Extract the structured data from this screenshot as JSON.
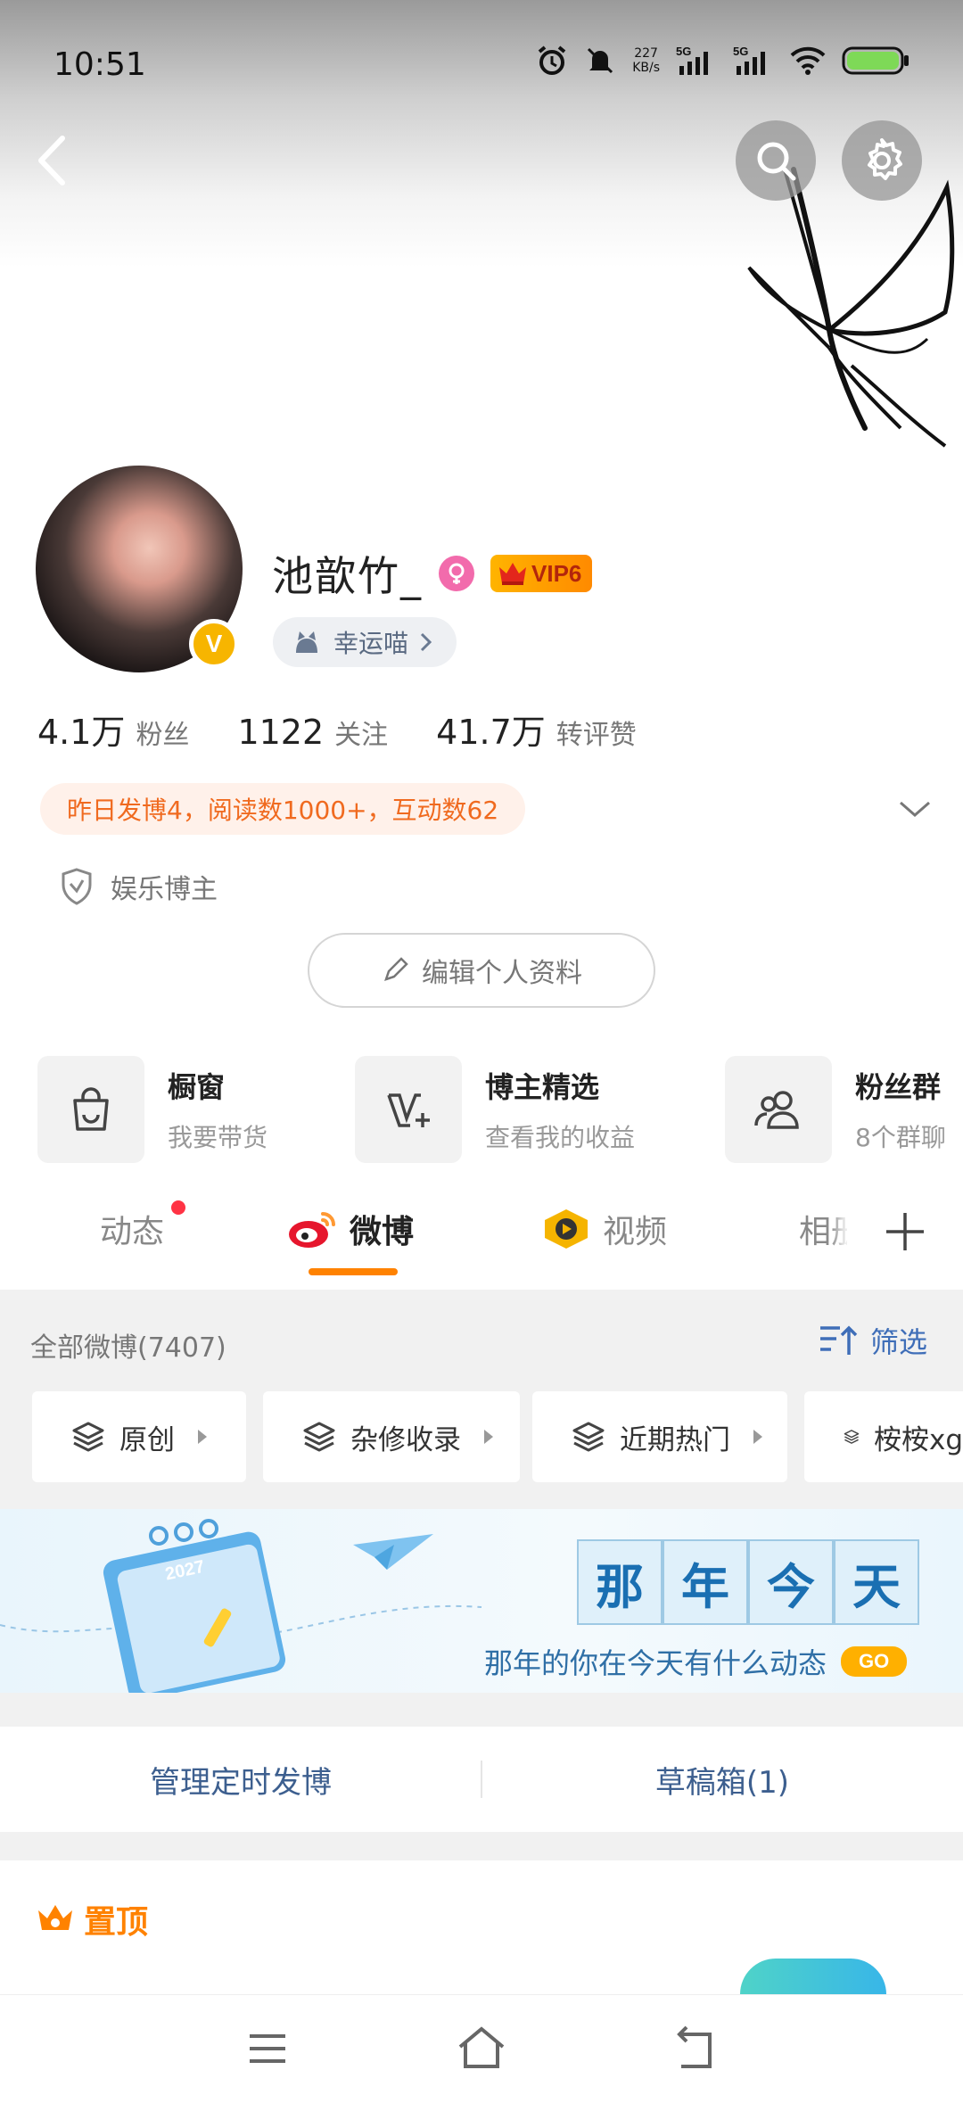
{
  "status_bar": {
    "time": "10:51",
    "net_speed_value": "227",
    "net_speed_unit": "KB/s",
    "sim1": "5G",
    "sim2": "5G"
  },
  "profile": {
    "name": "池歆竹_",
    "vip_label": "VIP6",
    "verified_mark": "V",
    "lucky_pill": "幸运喵",
    "stats": [
      {
        "num": "4.1万",
        "label": "粉丝"
      },
      {
        "num": "1122",
        "label": "关注"
      },
      {
        "num": "41.7万",
        "label": "转评赞"
      }
    ],
    "activity": "昨日发博4，阅读数1000+，互动数62",
    "tag": "娱乐博主",
    "edit_button": "编辑个人资料"
  },
  "features": [
    {
      "title": "橱窗",
      "subtitle": "我要带货",
      "icon": "bag-icon"
    },
    {
      "title": "博主精选",
      "subtitle": "查看我的收益",
      "icon": "v-plus-icon"
    },
    {
      "title": "粉丝群",
      "subtitle": "8个群聊",
      "icon": "group-icon"
    }
  ],
  "tabs": [
    {
      "label": "动态",
      "active": false,
      "has_dot": true
    },
    {
      "label": "微博",
      "active": true
    },
    {
      "label": "视频",
      "active": false
    },
    {
      "label": "相册",
      "active": false
    }
  ],
  "feed": {
    "count_label": "全部微博(7407)",
    "filter_label": "筛选",
    "chips": [
      "原创",
      "杂修收录",
      "近期热门",
      "桉桉xg"
    ],
    "banner": {
      "chars": [
        "那",
        "年",
        "今",
        "天"
      ],
      "subtitle": "那年的你在今天有什么动态",
      "go": "GO",
      "calendar_year": "2027"
    },
    "manage": [
      "管理定时发博",
      "草稿箱(1)"
    ],
    "pinned_label": "置顶"
  },
  "colors": {
    "accent_orange": "#ff8200",
    "link_blue": "#3f6eb8",
    "vip_gold": "#ffb400",
    "gender_pink": "#f26bac"
  }
}
